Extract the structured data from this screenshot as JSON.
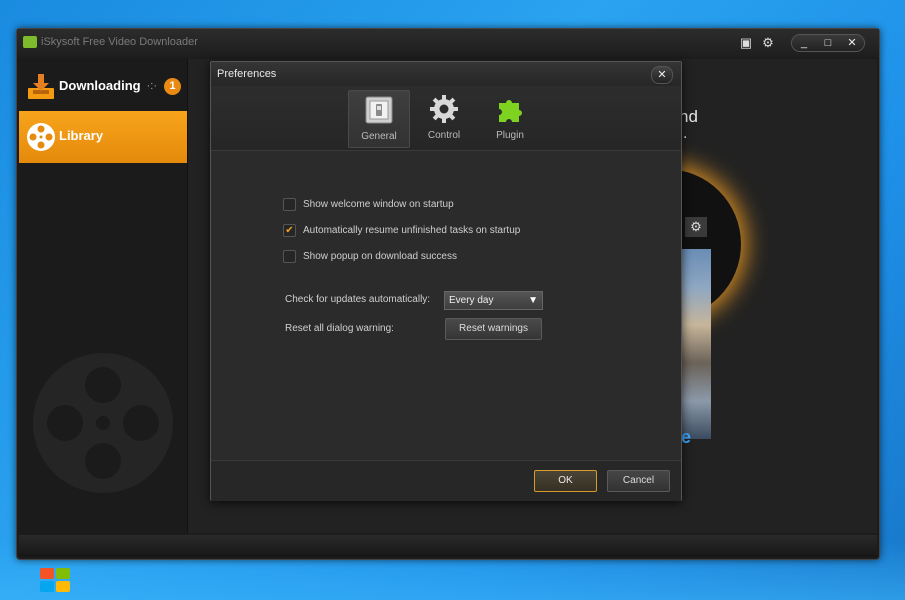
{
  "app": {
    "title": "iSkysoft Free Video Downloader",
    "accent_color": "#f39c12"
  },
  "titlebar": {
    "icons": [
      "screen-record-icon",
      "gear-icon"
    ],
    "controls": [
      "_",
      "□",
      "✕"
    ]
  },
  "sidebar": {
    "items": [
      {
        "label": "Downloading",
        "icon": "download-tray-icon",
        "count": "1",
        "active": false
      },
      {
        "label": "Library",
        "icon": "film-reel-icon",
        "active": true
      }
    ]
  },
  "background": {
    "partial_text_1": "nd",
    "partial_text_2": "."
  },
  "dialog": {
    "title": "Preferences",
    "close": "✕",
    "tabs": [
      {
        "label": "General",
        "icon": "general-switch-icon",
        "active": true
      },
      {
        "label": "Control",
        "icon": "gear-icon",
        "active": false
      },
      {
        "label": "Plugin",
        "icon": "puzzle-piece-icon",
        "active": false
      }
    ],
    "options": [
      {
        "label": "Show welcome window on startup",
        "checked": false
      },
      {
        "label": "Automatically resume unfinished tasks on startup",
        "checked": true
      },
      {
        "label": "Show popup on download success",
        "checked": false
      }
    ],
    "updates": {
      "label": "Check for updates automatically:",
      "value": "Every day"
    },
    "reset": {
      "label": "Reset all dialog warning:",
      "button": "Reset warnings"
    },
    "ok": "OK",
    "cancel": "Cancel"
  }
}
